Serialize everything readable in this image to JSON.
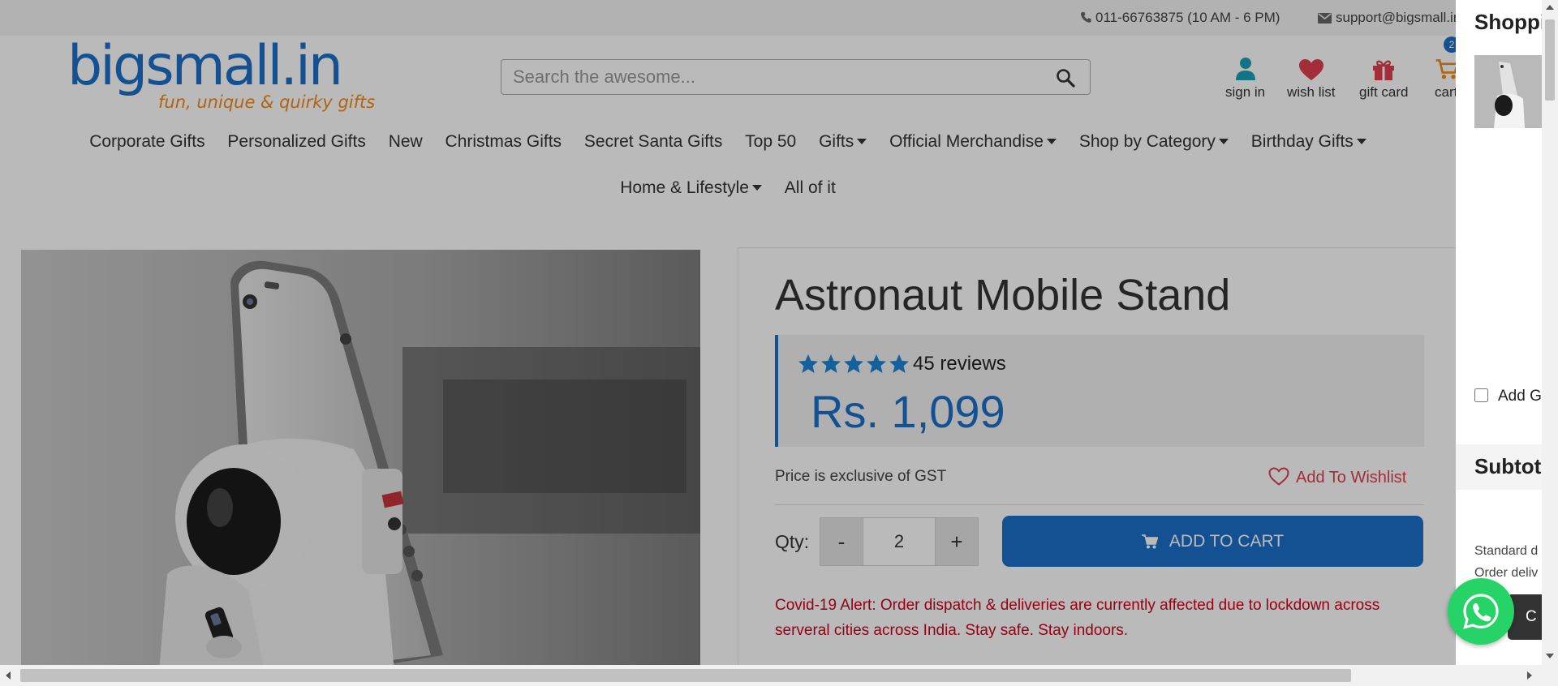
{
  "topbar": {
    "phone": "011-66763875 (10 AM - 6 PM)",
    "email": "support@bigsmall.in"
  },
  "logo": {
    "name": "bigsmall.in",
    "tagline": "fun, unique & quirky gifts"
  },
  "search": {
    "placeholder": "Search the awesome...",
    "value": ""
  },
  "header_icons": [
    {
      "label": "sign in",
      "icon": "user-icon",
      "color": "#1aa0b5"
    },
    {
      "label": "wish list",
      "icon": "heart-icon",
      "color": "#e0404f"
    },
    {
      "label": "gift card",
      "icon": "gift-icon",
      "color": "#e0404f"
    },
    {
      "label": "cart",
      "icon": "cart-icon",
      "color": "#f08a1c",
      "badge": "2"
    }
  ],
  "nav": {
    "row1": [
      {
        "label": "Corporate Gifts",
        "dropdown": false
      },
      {
        "label": "Personalized Gifts",
        "dropdown": false
      },
      {
        "label": "New",
        "dropdown": false
      },
      {
        "label": "Christmas Gifts",
        "dropdown": false
      },
      {
        "label": "Secret Santa Gifts",
        "dropdown": false
      },
      {
        "label": "Top 50",
        "dropdown": false
      },
      {
        "label": "Gifts",
        "dropdown": true
      },
      {
        "label": "Official Merchandise",
        "dropdown": true
      },
      {
        "label": "Shop by Category",
        "dropdown": true
      },
      {
        "label": "Birthday Gifts",
        "dropdown": true
      }
    ],
    "row2": [
      {
        "label": "Home & Lifestyle",
        "dropdown": true
      },
      {
        "label": "All of it",
        "dropdown": false
      }
    ]
  },
  "product": {
    "title": "Astronaut Mobile Stand",
    "rating": 5,
    "reviews": "45 reviews",
    "price": "Rs. 1,099",
    "gst_note": "Price is exclusive of GST",
    "wishlist_label": "Add To Wishlist",
    "qty_label": "Qty:",
    "qty_minus": "-",
    "qty_plus": "+",
    "qty_value": "2",
    "add_to_cart": "ADD TO CART",
    "covid_alert": "Covid-19 Alert: Order dispatch & deliveries are currently affected due to lockdown across serveral cities across India. Stay safe. Stay indoors."
  },
  "cart_drawer": {
    "title": "Shopping",
    "gift_option": "Add G",
    "subtotal": "Subtotal",
    "shipping_line1": "Standard d",
    "shipping_line2": "Order deliv",
    "checkout_peek": "C"
  },
  "colors": {
    "brand_blue": "#1b6fc8",
    "brand_orange": "#f08a1c",
    "alert_red": "#d0021b",
    "whatsapp_green": "#25d366"
  }
}
